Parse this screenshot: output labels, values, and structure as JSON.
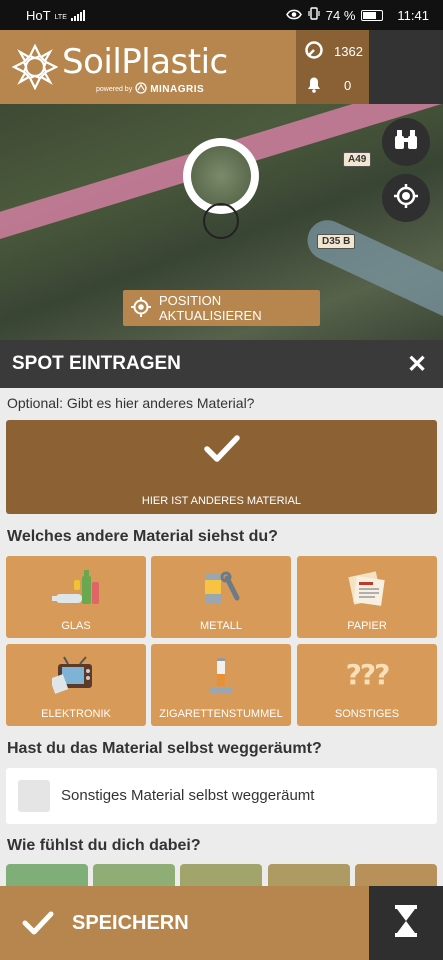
{
  "status_bar": {
    "carrier": "HoT",
    "network": "LTE",
    "battery": "74 %",
    "time": "11:41"
  },
  "header": {
    "brand": "SoilPlastic",
    "powered_by": "powered by",
    "partner": "MINAGRIS",
    "points_count": "1362",
    "notifications_count": "0"
  },
  "map": {
    "road_label_1": "A49",
    "road_label_2": "D35 B",
    "update_position_label": "POSITION AKTUALISIEREN"
  },
  "sheet": {
    "title": "SPOT EINTRAGEN",
    "optional_question": "Optional: Gibt es hier anderes Material?",
    "other_material_button": "HIER IST ANDERES MATERIAL",
    "material_question": "Welches andere Material siehst du?",
    "materials": [
      {
        "label": "GLAS"
      },
      {
        "label": "METALL"
      },
      {
        "label": "PAPIER"
      },
      {
        "label": "ELEKTRONIK"
      },
      {
        "label": "ZIGARETTENSTUMMEL"
      },
      {
        "label": "SONSTIGES"
      }
    ],
    "removed_question": "Hast du das Material selbst weggeräumt?",
    "removed_checkbox_label": "Sonstiges Material selbst weggeräumt",
    "feeling_question": "Wie fühlst du dich dabei?",
    "feeling_colors": [
      "#7fae78",
      "#8fae76",
      "#a1a56c",
      "#ad9b63",
      "#b8905a"
    ]
  },
  "footer": {
    "save_label": "SPEICHERN"
  },
  "colors": {
    "brand": "#b7864e",
    "brand_dark": "#8c6235",
    "tile": "#d79a58",
    "dark": "#2f2f2f"
  }
}
